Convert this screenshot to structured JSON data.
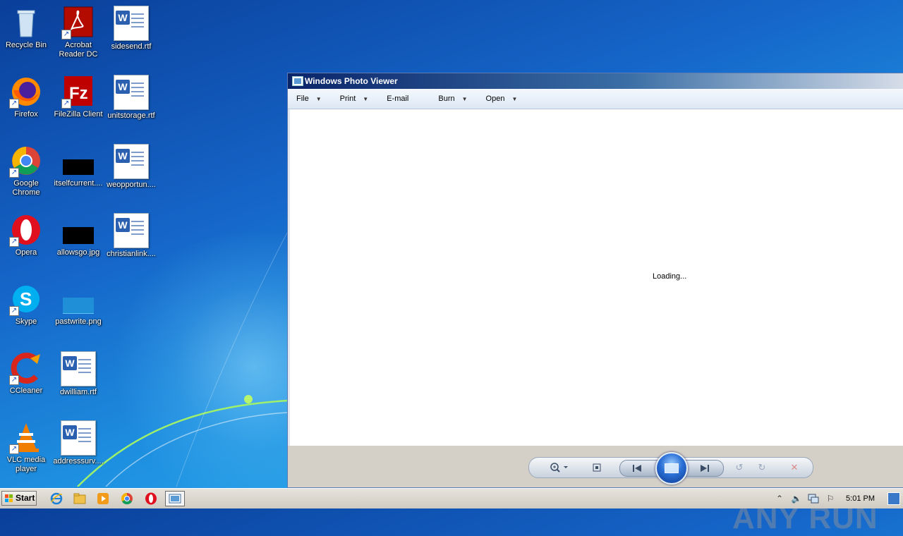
{
  "desktop": {
    "icons": [
      {
        "label": "Recycle Bin"
      },
      {
        "label": "Acrobat Reader DC"
      },
      {
        "label": "sidesend.rtf"
      },
      {
        "label": "Firefox"
      },
      {
        "label": "FileZilla Client"
      },
      {
        "label": "unitstorage.rtf"
      },
      {
        "label": "Google Chrome"
      },
      {
        "label": "itselfcurrent...."
      },
      {
        "label": "weopportun...."
      },
      {
        "label": "Opera"
      },
      {
        "label": "allowsgo.jpg"
      },
      {
        "label": "christianlink...."
      },
      {
        "label": "Skype"
      },
      {
        "label": "pastwrite.png"
      },
      {
        "label": "CCleaner"
      },
      {
        "label": "dwilliam.rtf"
      },
      {
        "label": "VLC media player"
      },
      {
        "label": "addresssurv...."
      }
    ]
  },
  "window": {
    "title": "Windows Photo Viewer",
    "menu": {
      "file": "File",
      "print": "Print",
      "email": "E-mail",
      "burn": "Burn",
      "open": "Open"
    },
    "status": "Loading...",
    "watermark": "ANY RUN"
  },
  "taskbar": {
    "start_label": "Start",
    "clock": "5:01 PM"
  },
  "colors": {
    "desktop_blue": "#1565c8",
    "title_blue": "#0a246a",
    "taskbar": "#d4d0c8"
  }
}
